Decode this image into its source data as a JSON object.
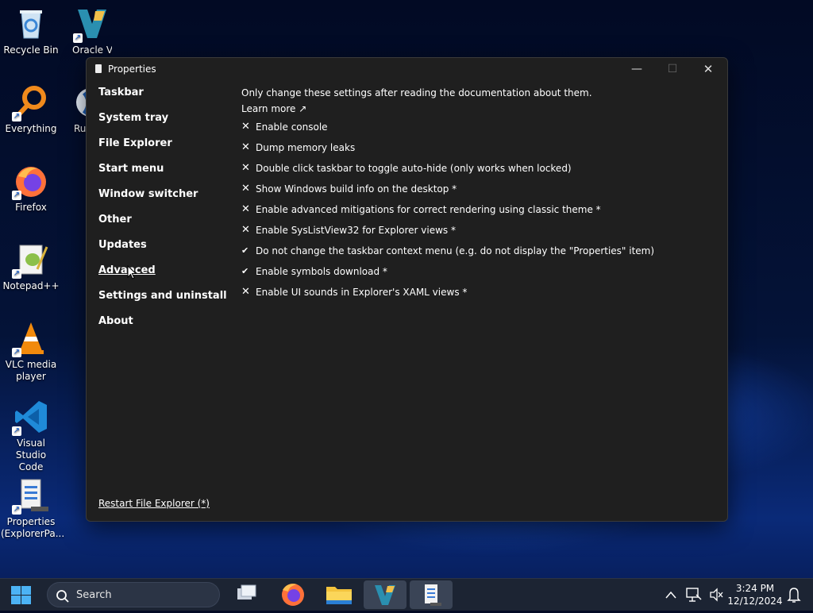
{
  "desktop": {
    "icons": [
      {
        "label": "Recycle Bin",
        "icon": "recycle-bin-icon"
      },
      {
        "label": "Oracle Virt",
        "icon": "virtualbox-icon"
      },
      {
        "label": "Everything",
        "icon": "everything-search-icon"
      },
      {
        "label": "Rus",
        "icon": "rufus-icon"
      },
      {
        "label": "Firefox",
        "icon": "firefox-icon"
      },
      {
        "label": "Notepad++",
        "icon": "notepadpp-icon"
      },
      {
        "label": "VLC media player",
        "icon": "vlc-icon"
      },
      {
        "label": "Visual Studio Code",
        "icon": "vscode-icon"
      },
      {
        "label": "Properties (ExplorerPa...",
        "icon": "properties-icon"
      }
    ]
  },
  "window": {
    "title": "Properties",
    "controls": {
      "minimize": "—",
      "maximize": "☐",
      "close": "✕"
    }
  },
  "nav": {
    "items": [
      {
        "label": "Taskbar"
      },
      {
        "label": "System tray"
      },
      {
        "label": "File Explorer"
      },
      {
        "label": "Start menu"
      },
      {
        "label": "Window switcher"
      },
      {
        "label": "Other"
      },
      {
        "label": "Updates"
      },
      {
        "label": "Advanced",
        "selected": true
      },
      {
        "label": "Settings and uninstall"
      },
      {
        "label": "About"
      }
    ],
    "restart_link": "Restart File Explorer (*)"
  },
  "content": {
    "info": "Only change these settings after reading the documentation about them.",
    "learn_more": "Learn more ↗",
    "options": [
      {
        "mark": "✕",
        "label": "Enable console",
        "checked": false
      },
      {
        "mark": "✕",
        "label": "Dump memory leaks",
        "checked": false
      },
      {
        "mark": "✕",
        "label": "Double click taskbar to toggle auto-hide (only works when locked)",
        "checked": false
      },
      {
        "mark": "✕",
        "label": "Show Windows build info on the desktop *",
        "checked": false
      },
      {
        "mark": "✕",
        "label": "Enable advanced mitigations for correct rendering using classic theme *",
        "checked": false
      },
      {
        "mark": "✕",
        "label": "Enable SysListView32 for Explorer views *",
        "checked": false
      },
      {
        "mark": "✔",
        "label": "Do not change the taskbar context menu (e.g. do not display the \"Properties\" item)",
        "checked": true
      },
      {
        "mark": "✔",
        "label": "Enable symbols download *",
        "checked": true
      },
      {
        "mark": "✕",
        "label": "Enable UI sounds in Explorer's XAML views *",
        "checked": false
      }
    ]
  },
  "taskbar": {
    "search_label": "Search",
    "apps": [
      "task-view-icon",
      "firefox-icon",
      "file-explorer-icon",
      "virtualbox-icon",
      "properties-icon"
    ],
    "time": "3:24 PM",
    "date": "12/12/2024"
  }
}
